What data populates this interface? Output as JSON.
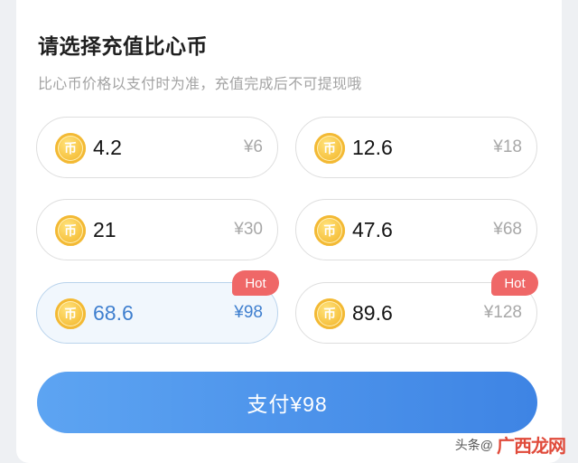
{
  "header": {
    "title": "请选择充值比心币",
    "subtitle": "比心币价格以支付时为准，充值完成后不可提现哦"
  },
  "coin_icon": {
    "glyph": "币",
    "icon": "coin-icon",
    "color": "#f7c443"
  },
  "options": [
    {
      "amount": "4.2",
      "price": "¥6",
      "hot": "",
      "selected": false
    },
    {
      "amount": "12.6",
      "price": "¥18",
      "hot": "",
      "selected": false
    },
    {
      "amount": "21",
      "price": "¥30",
      "hot": "",
      "selected": false
    },
    {
      "amount": "47.6",
      "price": "¥68",
      "hot": "",
      "selected": false
    },
    {
      "amount": "68.6",
      "price": "¥98",
      "hot": "Hot",
      "selected": true
    },
    {
      "amount": "89.6",
      "price": "¥128",
      "hot": "Hot",
      "selected": false
    }
  ],
  "pay_button": {
    "label": "支付¥98"
  },
  "watermark": {
    "prefix": "头条@",
    "logo_text": "广西龙网"
  },
  "colors": {
    "accent": "#3e84e4",
    "hot": "#ef6767",
    "selected_text": "#3f7fcf"
  }
}
